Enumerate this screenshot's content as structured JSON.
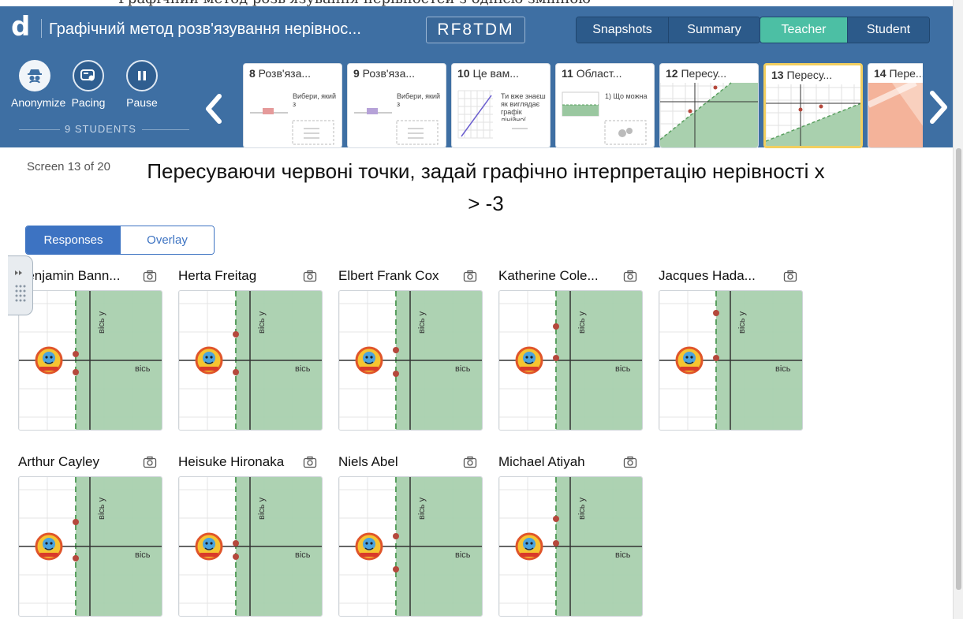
{
  "top_strip_text": "Графічний метод розв'язування нерівностей з однією змінною",
  "header": {
    "logo": "d",
    "activity_title": "Графічний метод розв'язування нерівнос...",
    "class_code": "RF8TDM",
    "nav": {
      "snapshots": "Snapshots",
      "summary": "Summary",
      "teacher": "Teacher",
      "student": "Student"
    },
    "active_mode": "Teacher",
    "controls": {
      "anonymize": "Anonymize",
      "pacing": "Pacing",
      "pause": "Pause"
    },
    "students_count": "9 STUDENTS"
  },
  "screens": [
    {
      "num": "8",
      "title": "Розв'яза...",
      "body": "Вибери, який з",
      "kind": "bar"
    },
    {
      "num": "9",
      "title": "Розв'яза...",
      "body": "Вибери, який з",
      "kind": "bar2"
    },
    {
      "num": "10",
      "title": "Це вам...",
      "body": "Ти вже знаєш як виглядає графік лінійної",
      "kind": "line"
    },
    {
      "num": "11",
      "title": "Област...",
      "body": "1) Що можна",
      "kind": "region"
    },
    {
      "num": "12",
      "title": "Пересу...",
      "body": "",
      "kind": "graph-green"
    },
    {
      "num": "13",
      "title": "Пересу...",
      "body": "",
      "kind": "graph-green",
      "selected": true
    },
    {
      "num": "14",
      "title": "Пере...",
      "body": "",
      "kind": "graph-orange"
    }
  ],
  "screen_counter": "Screen 13 of 20",
  "prompt": "Пересуваючи червоні точки, задай графічно інтерпретацію нерівності x > -3",
  "tabs": {
    "responses": "Responses",
    "overlay": "Overlay"
  },
  "axis_labels": {
    "y": "вісь у",
    "x": "вісь"
  },
  "colors": {
    "header": "#3e6fa3",
    "teacher_active": "#4cbfa4",
    "selected_thumb": "#f2cf60",
    "region_fill": "#a9d0ae",
    "boundary": "#5aa060",
    "point": "#b5483c",
    "accent_blue": "#3d73c2"
  },
  "students": [
    {
      "name": "Benjamin Bann...",
      "points": [
        0.45,
        0.58
      ]
    },
    {
      "name": "Herta Freitag",
      "points": [
        0.31,
        0.58
      ]
    },
    {
      "name": "Elbert Frank Cox",
      "points": [
        0.42,
        0.59
      ]
    },
    {
      "name": "Katherine Cole...",
      "points": [
        0.25,
        0.48
      ]
    },
    {
      "name": "Jacques Hada...",
      "points": [
        0.16,
        0.48
      ]
    },
    {
      "name": "Arthur Cayley",
      "points": [
        0.32,
        0.58
      ]
    },
    {
      "name": "Heisuke Hironaka",
      "points": [
        0.47,
        0.57
      ]
    },
    {
      "name": "Niels Abel",
      "points": [
        0.42,
        0.66
      ]
    },
    {
      "name": "Michael Atiyah",
      "points": [
        0.3,
        0.47
      ]
    }
  ]
}
